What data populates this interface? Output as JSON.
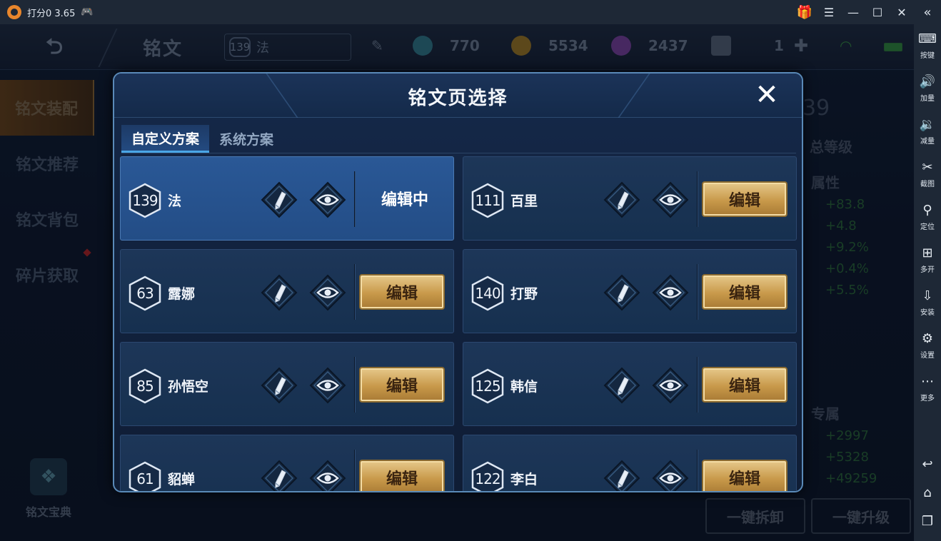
{
  "emulator": {
    "title": "打分0 3.65",
    "sidebar": [
      {
        "icon": "keyboard-icon",
        "label": "按键"
      },
      {
        "icon": "volume-up-icon",
        "label": "加量"
      },
      {
        "icon": "volume-down-icon",
        "label": "减量"
      },
      {
        "icon": "scissors-icon",
        "label": "截图"
      },
      {
        "icon": "location-icon",
        "label": "定位"
      },
      {
        "icon": "multi-open-icon",
        "label": "多开"
      },
      {
        "icon": "apk-install-icon",
        "label": "安装"
      },
      {
        "icon": "gear-icon",
        "label": "设置"
      },
      {
        "icon": "more-icon",
        "label": "更多"
      }
    ]
  },
  "game": {
    "page_title": "铭文",
    "current_page": {
      "level": "139",
      "name": "法"
    },
    "resources": [
      {
        "icon": "diamond-icon",
        "value": "770",
        "color": "#2a6a78"
      },
      {
        "icon": "gold-coin-icon",
        "value": "5534",
        "color": "#8a6a20"
      },
      {
        "icon": "crystal-icon",
        "value": "2437",
        "color": "#6a3a8a"
      },
      {
        "icon": "ticket-icon",
        "value": "1",
        "color": "#4a5668"
      }
    ],
    "left_nav": [
      "铭文装配",
      "铭文推荐",
      "铭文背包",
      "碎片获取"
    ],
    "codex_label": "铭文宝典",
    "right_panel": {
      "level_digits": "39",
      "total_level_label": "总等级",
      "attr_label": "属性",
      "attr_values": [
        "+83.8",
        "+4.8",
        "+9.2%",
        "+0.4%",
        "+5.5%"
      ],
      "exclusive_label": "专属",
      "exclusive_values": [
        "+2997",
        "+5328",
        "+49259"
      ]
    },
    "buttons": {
      "unload_all": "一键拆卸",
      "upgrade_all": "一键升级"
    }
  },
  "modal": {
    "title": "铭文页选择",
    "tabs": [
      {
        "label": "自定义方案",
        "active": true
      },
      {
        "label": "系统方案",
        "active": false
      }
    ],
    "editing_label": "编辑中",
    "edit_label": "编辑",
    "pages": [
      {
        "level": "139",
        "name": "法",
        "active": true
      },
      {
        "level": "111",
        "name": "百里",
        "active": false
      },
      {
        "level": "63",
        "name": "露娜",
        "active": false
      },
      {
        "level": "140",
        "name": "打野",
        "active": false
      },
      {
        "level": "85",
        "name": "孙悟空",
        "active": false
      },
      {
        "level": "125",
        "name": "韩信",
        "active": false
      },
      {
        "level": "61",
        "name": "貂蝉",
        "active": false
      },
      {
        "level": "122",
        "name": "李白",
        "active": false
      }
    ]
  }
}
